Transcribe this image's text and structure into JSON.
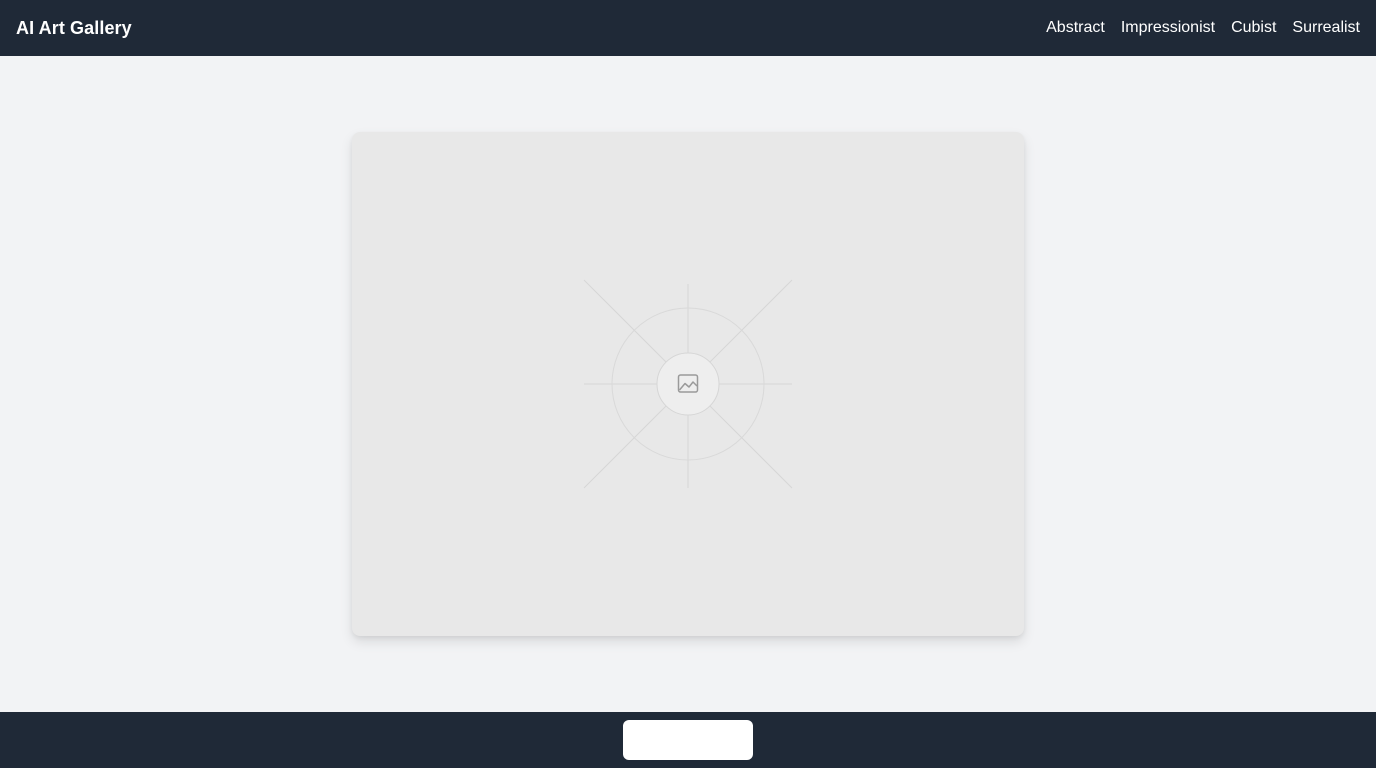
{
  "header": {
    "brand": "AI Art Gallery",
    "nav": [
      {
        "label": "Abstract"
      },
      {
        "label": "Impressionist"
      },
      {
        "label": "Cubist"
      },
      {
        "label": "Surrealist"
      }
    ]
  },
  "main": {
    "artwork": {
      "icon": "image-placeholder-icon"
    }
  },
  "footer": {
    "button_label": ""
  },
  "colors": {
    "header_bg": "#1f2937",
    "page_bg": "#f2f3f5",
    "card_bg": "#e8e8e8",
    "text_light": "#ffffff"
  }
}
